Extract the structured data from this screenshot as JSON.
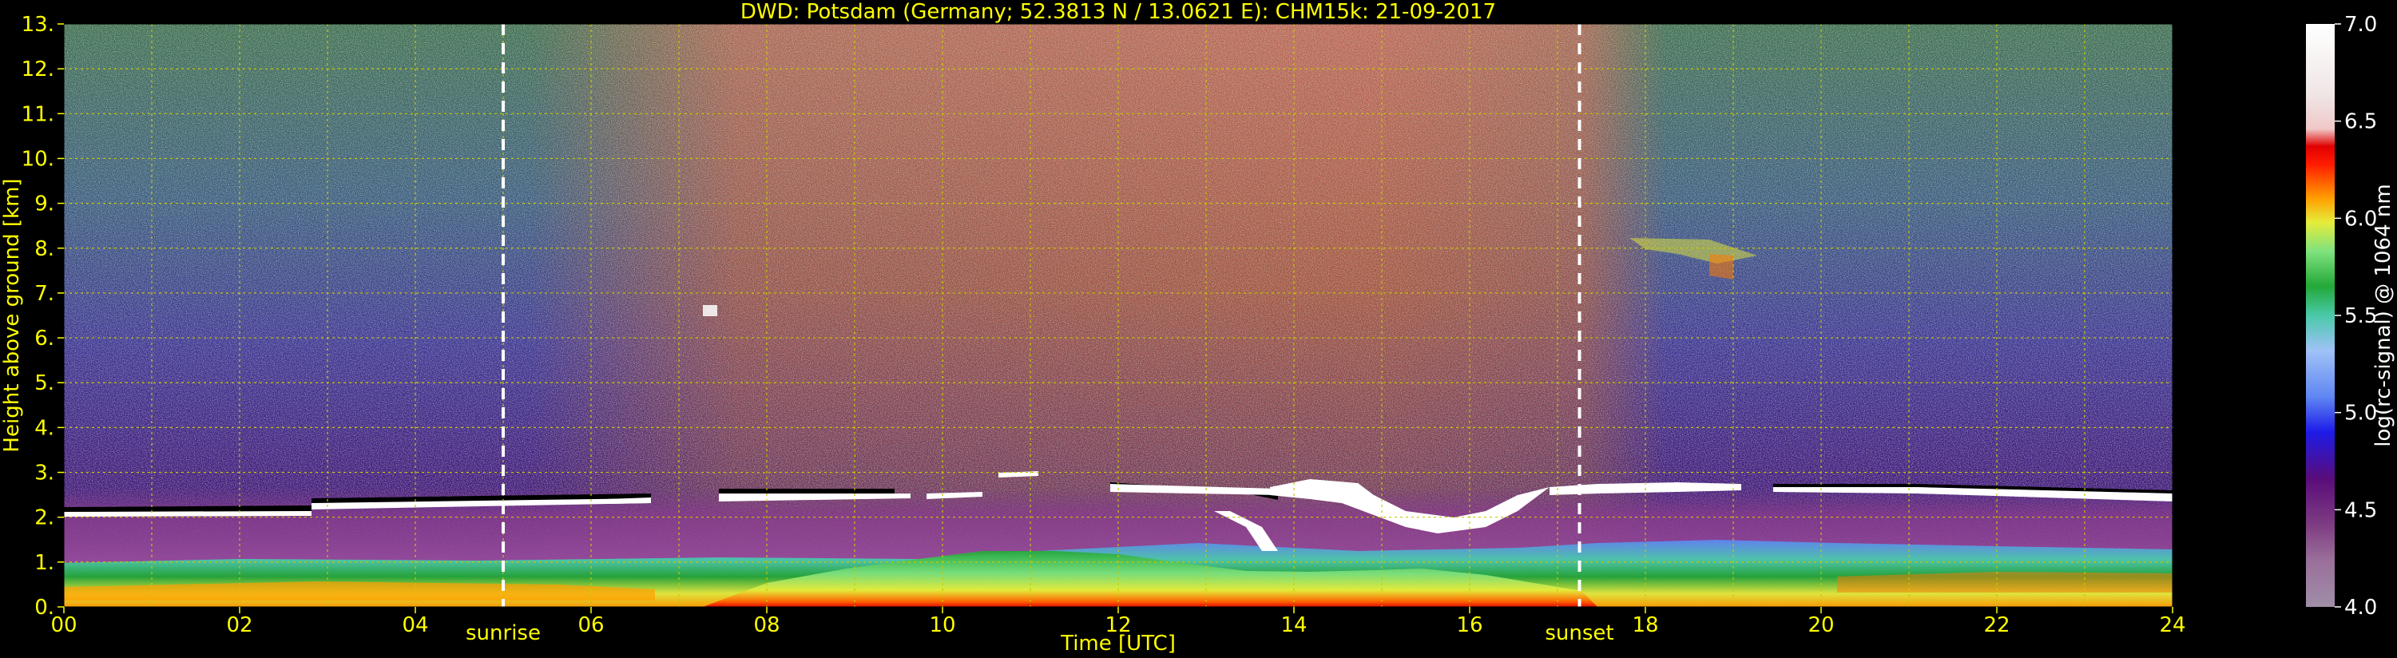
{
  "chart_data": {
    "type": "heatmap",
    "title": "DWD: Potsdam (Germany; 52.3813 N / 13.0621 E):    CHM15k: 21-09-2017",
    "xlabel": "Time [UTC]",
    "ylabel": "Height above ground [km]",
    "x_range": [
      0,
      24
    ],
    "y_range": [
      0,
      13
    ],
    "x_ticks": [
      "00",
      "02",
      "04",
      "06",
      "08",
      "10",
      "12",
      "14",
      "16",
      "18",
      "20",
      "22",
      "24"
    ],
    "y_ticks": [
      "0.",
      "1.",
      "2.",
      "3.",
      "4.",
      "5.",
      "6.",
      "7.",
      "8.",
      "9.",
      "10.",
      "11.",
      "12.",
      "13."
    ],
    "grid": true,
    "colorbar": {
      "label": "log(rc-signal) @ 1064 nm",
      "range": [
        4.0,
        7.0
      ],
      "ticks": [
        "4.0",
        "4.5",
        "5.0",
        "5.5",
        "6.0",
        "6.5",
        "7.0"
      ]
    },
    "annotations": [
      {
        "label": "sunrise",
        "x": 5.0
      },
      {
        "label": "sunset",
        "x": 17.25
      }
    ],
    "colors": {
      "text": "#ffff00",
      "grid": "#c8c800",
      "background": "#000000",
      "colormap": [
        "#a08ea8",
        "#9a6f9a",
        "#7e3d82",
        "#5a0c7a",
        "#1d1be8",
        "#5f86f2",
        "#9fc2f6",
        "#49c9a9",
        "#23a838",
        "#7fe27e",
        "#e6ec3a",
        "#ffa000",
        "#ff1a00",
        "#e00000",
        "#f0c8c8",
        "#f0e6e6",
        "#ffffff"
      ]
    }
  }
}
